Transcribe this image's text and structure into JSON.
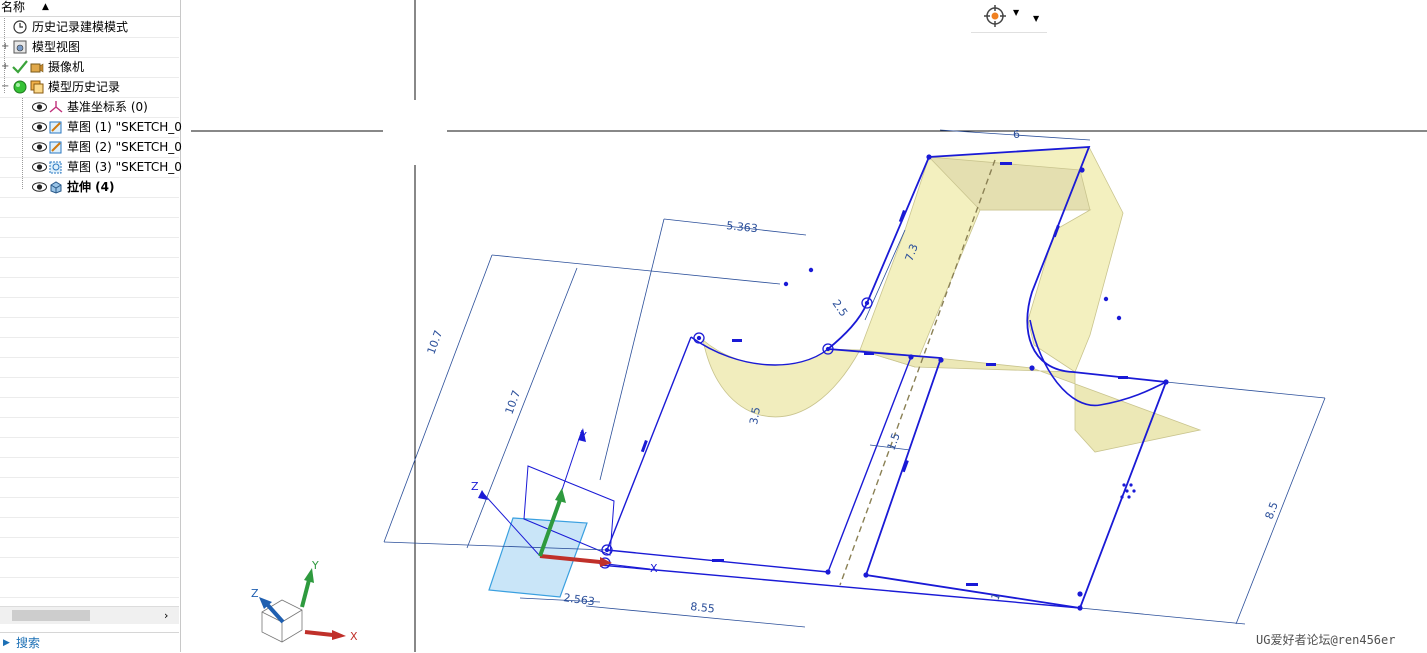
{
  "navigator": {
    "header_name": "名称",
    "sort_glyph": "▲",
    "items": [
      {
        "label": "历史记录建模模式",
        "icon": "clock-icon"
      },
      {
        "label": "模型视图",
        "icon": "model-view-icon",
        "expander": "+"
      },
      {
        "label": "摄像机",
        "icon": "camera-icon",
        "expander": "+"
      },
      {
        "label": "模型历史记录",
        "icon": "history-icon",
        "expander": "−"
      },
      {
        "label": "基准坐标系 (0)",
        "icon": "datum-csys-icon"
      },
      {
        "label": "草图 (1) \"SKETCH_0",
        "icon": "sketch-icon"
      },
      {
        "label": "草图 (2) \"SKETCH_0",
        "icon": "sketch-icon"
      },
      {
        "label": "草图 (3) \"SKETCH_0",
        "icon": "sketch-icon"
      },
      {
        "label": "拉伸 (4)",
        "icon": "extrude-icon"
      }
    ],
    "search_label": "搜索"
  },
  "viewport": {
    "dimensions": {
      "top_width": "6",
      "d_5_363": "5.363",
      "d_7_3": "7.3",
      "d_2_5": "2.5",
      "d_10_7_outer": "10.7",
      "d_10_7_inner": "10.7",
      "d_3_5": "3.5",
      "d_1_5": "1.5",
      "d_8_5": "8.5",
      "d_2_563": "2.563",
      "d_8_55": "8.55",
      "d_1": "1"
    },
    "axes": {
      "x": "X",
      "y": "Y",
      "z": "Z"
    }
  },
  "watermark": "UG爱好者论坛@ren456er",
  "colors": {
    "sketch": "#1a1ad6",
    "dimension": "#2b4f9a",
    "surface": "#f3f0bf",
    "surface_edge": "#c9c48e",
    "datum_plane": "#bfe1f7",
    "x_axis": "#c0302a",
    "y_axis": "#2e9a3e",
    "z_axis": "#1f5fb0"
  }
}
